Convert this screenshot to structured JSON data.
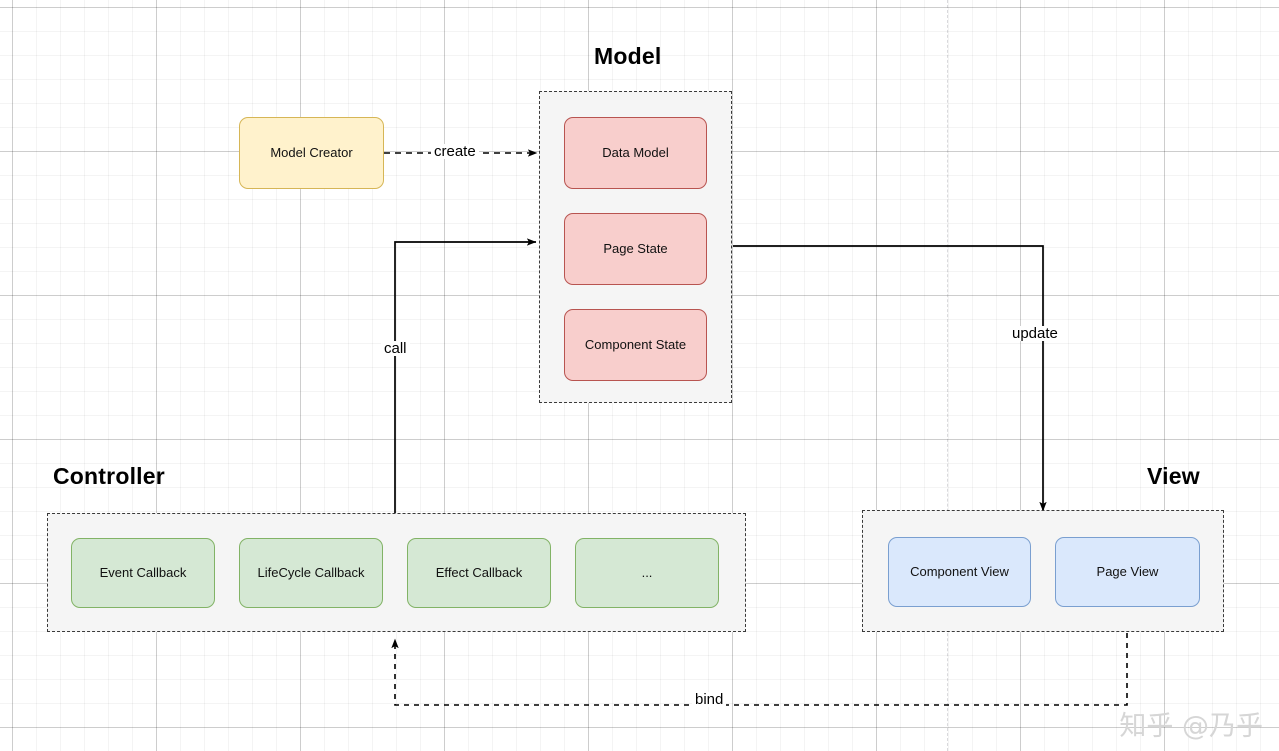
{
  "diagram": {
    "title_model": "Model",
    "title_controller": "Controller",
    "title_view": "View"
  },
  "model_group": {
    "nodes": [
      {
        "label": "Data Model"
      },
      {
        "label": "Page State"
      },
      {
        "label": "Component State"
      }
    ]
  },
  "creator": {
    "label": "Model Creator"
  },
  "controller_group": {
    "nodes": [
      {
        "label": "Event Callback"
      },
      {
        "label": "LifeCycle Callback"
      },
      {
        "label": "Effect Callback"
      },
      {
        "label": "..."
      }
    ]
  },
  "view_group": {
    "nodes": [
      {
        "label": "Component View"
      },
      {
        "label": "Page View"
      }
    ]
  },
  "edges": {
    "create": "create",
    "call": "call",
    "update": "update",
    "bind": "bind"
  },
  "watermark": {
    "text": "知乎 @乃乎"
  },
  "colors": {
    "pink_fill": "#f8cecc",
    "pink_border": "#b85450",
    "green_fill": "#d5e8d4",
    "green_border": "#82b366",
    "blue_fill": "#dae8fc",
    "blue_border": "#7a9fd0",
    "yellow_fill": "#fff2cc",
    "yellow_border": "#d6b656",
    "group_fill": "#f5f5f5",
    "group_border": "#3a3a3a",
    "edge_stroke": "#000000",
    "watermark": "#d6d6d6"
  }
}
